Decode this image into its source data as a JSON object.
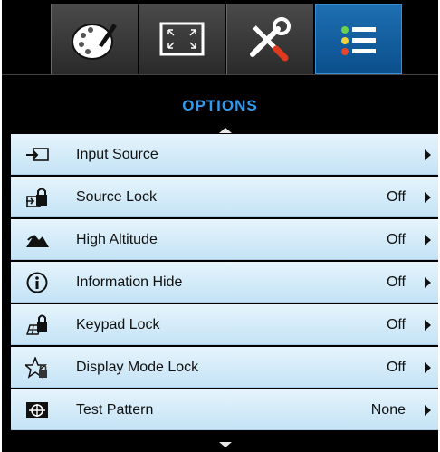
{
  "tabs": [
    {
      "icon": "palette-icon",
      "active": false
    },
    {
      "icon": "display-resize-icon",
      "active": false
    },
    {
      "icon": "tools-icon",
      "active": false
    },
    {
      "icon": "options-list-icon",
      "active": true
    }
  ],
  "menu": {
    "title": "OPTIONS",
    "items": [
      {
        "label": "Input Source",
        "value": "",
        "icon": "input-source-icon"
      },
      {
        "label": "Source Lock",
        "value": "Off",
        "icon": "source-lock-icon"
      },
      {
        "label": "High Altitude",
        "value": "Off",
        "icon": "high-altitude-icon"
      },
      {
        "label": "Information Hide",
        "value": "Off",
        "icon": "information-icon"
      },
      {
        "label": "Keypad Lock",
        "value": "Off",
        "icon": "keypad-lock-icon"
      },
      {
        "label": "Display Mode Lock",
        "value": "Off",
        "icon": "display-mode-lock-icon"
      },
      {
        "label": "Test Pattern",
        "value": "None",
        "icon": "test-pattern-icon"
      }
    ]
  },
  "colors": {
    "accent": "#2f9bef",
    "row_top": "#e6f4fc",
    "row_bottom": "#c4e3f6"
  }
}
